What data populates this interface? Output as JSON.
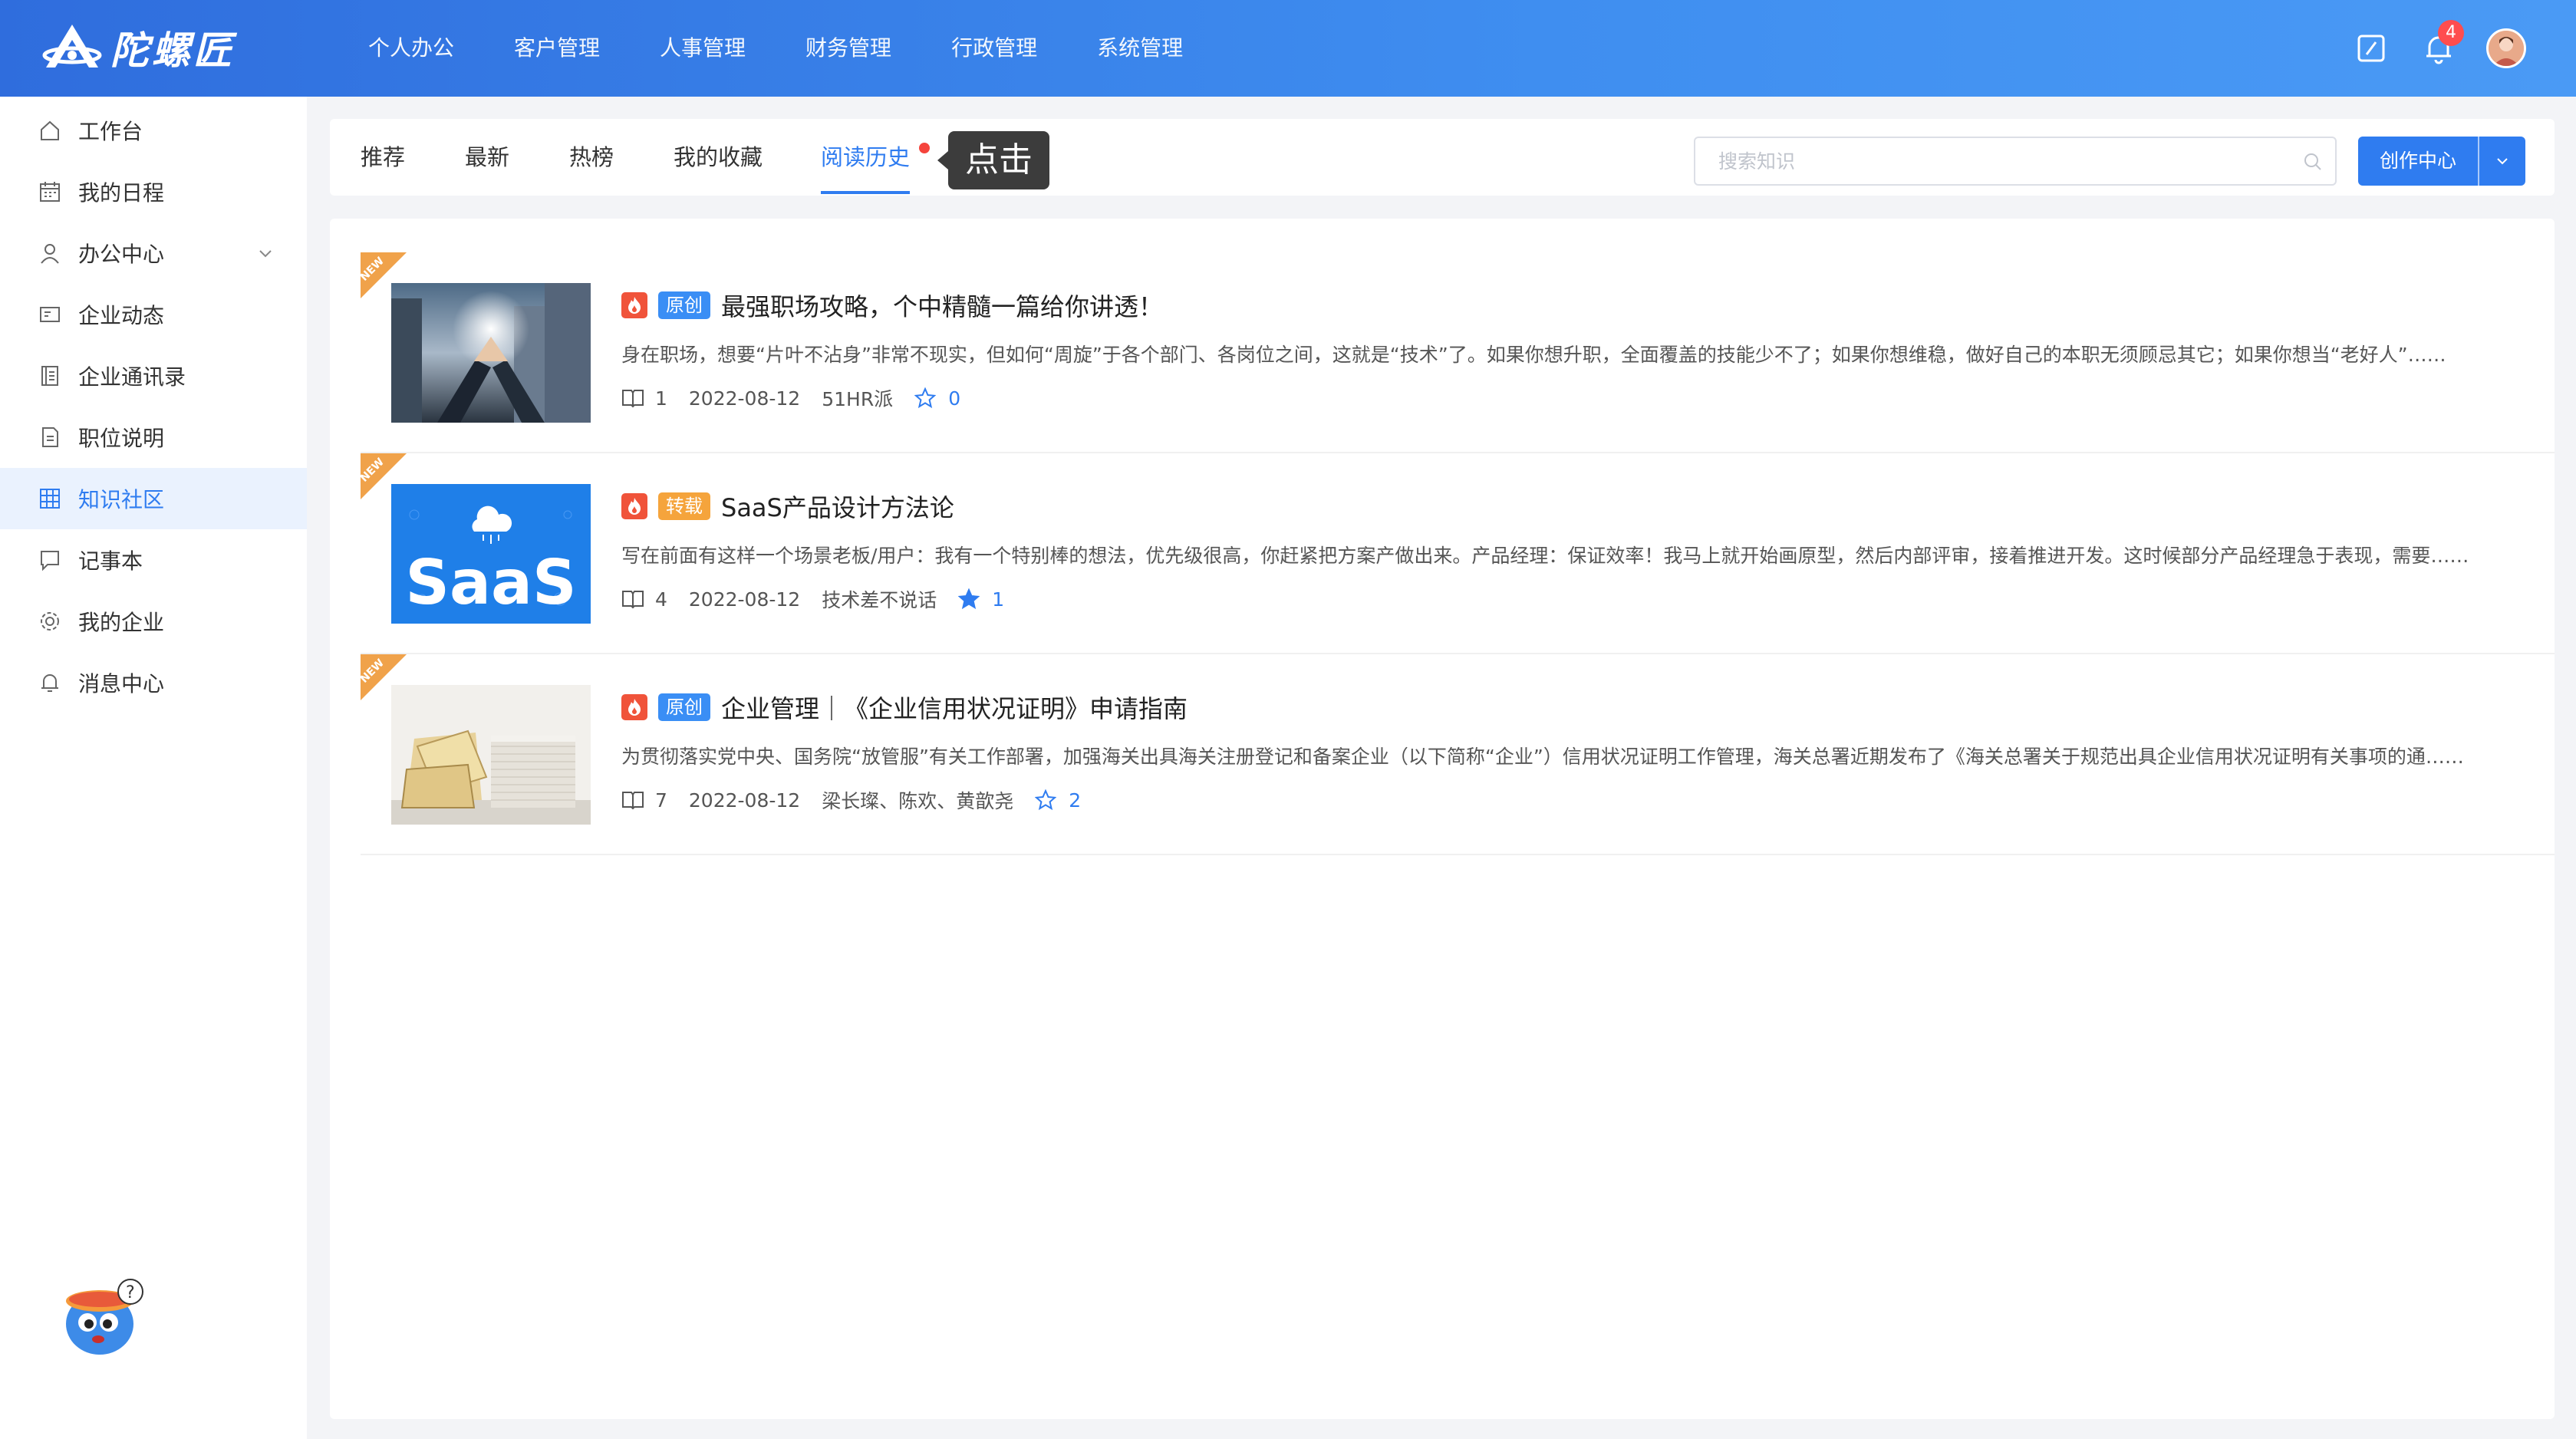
{
  "app": {
    "logo_text": "陀螺匠"
  },
  "topnav": [
    "个人办公",
    "客户管理",
    "人事管理",
    "财务管理",
    "行政管理",
    "系统管理"
  ],
  "header": {
    "notification_count": "4"
  },
  "sidebar": {
    "items": [
      {
        "label": "工作台",
        "icon": "home-icon"
      },
      {
        "label": "我的日程",
        "icon": "calendar-icon"
      },
      {
        "label": "办公中心",
        "icon": "user-icon"
      },
      {
        "label": "企业动态",
        "icon": "news-icon"
      },
      {
        "label": "企业通讯录",
        "icon": "contacts-icon"
      },
      {
        "label": "职位说明",
        "icon": "document-icon"
      },
      {
        "label": "知识社区",
        "icon": "grid-icon"
      },
      {
        "label": "记事本",
        "icon": "chat-icon"
      },
      {
        "label": "我的企业",
        "icon": "gear-icon"
      },
      {
        "label": "消息中心",
        "icon": "bell-icon"
      }
    ],
    "active": "知识社区"
  },
  "tabs": [
    "推荐",
    "最新",
    "热榜",
    "我的收藏",
    "阅读历史"
  ],
  "active_tab": "阅读历史",
  "tooltip": "点击",
  "search": {
    "placeholder": "搜索知识"
  },
  "create_button": "创作中心",
  "articles": [
    {
      "ribbon": "NEW",
      "tag": "原创",
      "title": "最强职场攻略，个中精髓一篇给你讲透！",
      "summary": "身在职场，想要“片叶不沾身”非常不现实，但如何“周旋”于各个部门、各岗位之间，这就是“技术”了。如果你想升职，全面覆盖的技能少不了；如果你想维稳，做好自己的本职无须顾忌其它；如果你想当“老好人”……",
      "reads": "1",
      "date": "2022-08-12",
      "author": "51HR派",
      "stars": "0"
    },
    {
      "ribbon": "NEW",
      "tag": "转载",
      "title": "SaaS产品设计方法论",
      "thumb_text": "SaaS",
      "summary": "写在前面有这样一个场景老板/用户：我有一个特别棒的想法，优先级很高，你赶紧把方案产做出来。产品经理：保证效率！我马上就开始画原型，然后内部评审，接着推进开发。这时候部分产品经理急于表现，需要……",
      "reads": "4",
      "date": "2022-08-12",
      "author": "技术差不说话",
      "stars": "1"
    },
    {
      "ribbon": "NEW",
      "tag": "原创",
      "title": "企业管理｜《企业信用状况证明》申请指南",
      "summary": "为贯彻落实党中央、国务院“放管服”有关工作部署，加强海关出具海关注册登记和备案企业（以下简称“企业”）信用状况证明工作管理，海关总署近期发布了《海关总署关于规范出具企业信用状况证明有关事项的通……",
      "reads": "7",
      "date": "2022-08-12",
      "author": "梁长璨、陈欢、黄歆尧",
      "stars": "2"
    }
  ],
  "colors": {
    "primary": "#2f7cf0",
    "header": "#3f8ef0",
    "fire": "#f0533a",
    "tag_original": "#3a8ef5",
    "tag_repost": "#f5a43c",
    "ribbon": "#f0a24a"
  }
}
